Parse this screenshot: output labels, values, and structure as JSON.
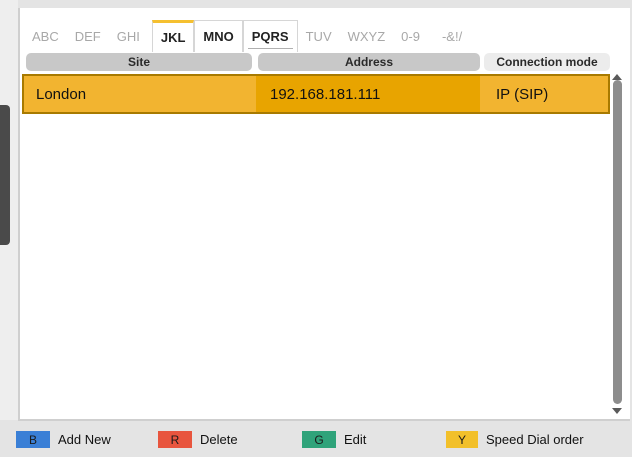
{
  "tabs": [
    {
      "label": "ABC",
      "state": "dim"
    },
    {
      "label": "DEF",
      "state": "dim"
    },
    {
      "label": "GHI",
      "state": "dim"
    },
    {
      "label": "JKL",
      "state": "active"
    },
    {
      "label": "MNO",
      "state": "boxed"
    },
    {
      "label": "PQRS",
      "state": "boxed"
    },
    {
      "label": "TUV",
      "state": "dim"
    },
    {
      "label": "WXYZ",
      "state": "dim"
    },
    {
      "label": "0-9",
      "state": "dim"
    },
    {
      "label": "-&!/",
      "state": "dim"
    }
  ],
  "table": {
    "headers": {
      "site": "Site",
      "address": "Address",
      "mode": "Connection mode"
    },
    "rows": [
      {
        "site": "London",
        "address": "192.168.181.111",
        "mode": "IP (SIP)"
      }
    ]
  },
  "footer": {
    "add": {
      "key": "B",
      "label": "Add New",
      "color": "#3a7fd6"
    },
    "delete": {
      "key": "R",
      "label": "Delete",
      "color": "#e8553e"
    },
    "edit": {
      "key": "G",
      "label": "Edit",
      "color": "#2fa37a"
    },
    "speed": {
      "key": "Y",
      "label": "Speed Dial order",
      "color": "#f2c02a"
    }
  },
  "colors": {
    "highlight": "#f2b430",
    "highlight_dark": "#e8a400",
    "accent_tab": "#f5c030"
  }
}
